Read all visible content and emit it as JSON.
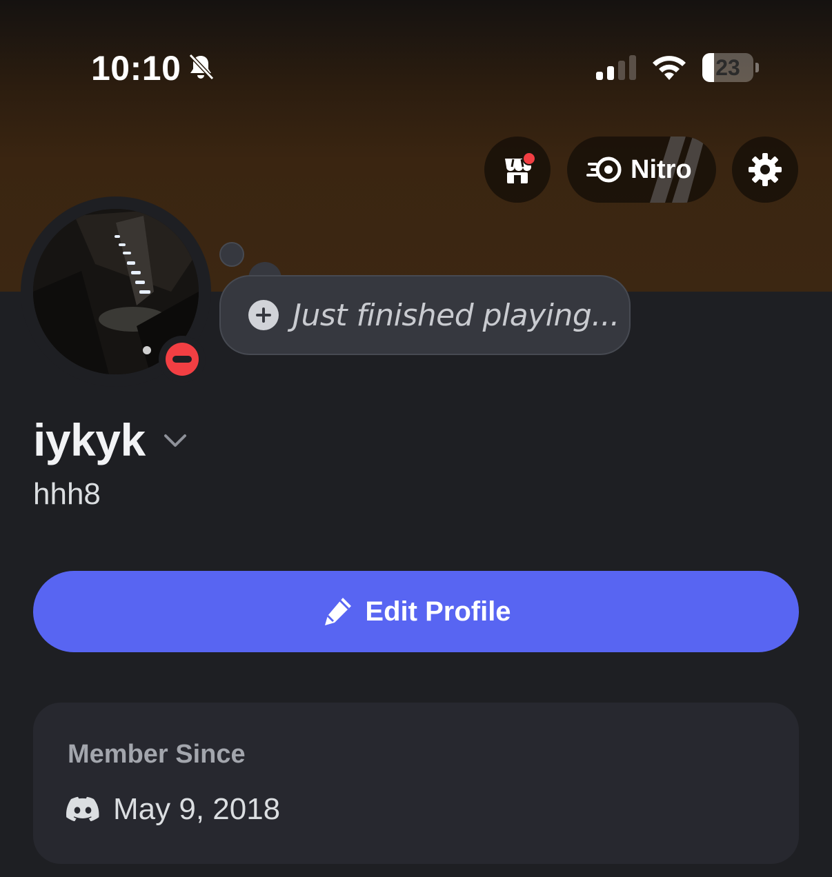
{
  "status_bar": {
    "time": "10:10",
    "battery_level": "23",
    "battery_fraction": 0.23
  },
  "top_actions": {
    "shop_icon": "shop-icon",
    "nitro_label": "Nitro",
    "settings_icon": "gear-icon"
  },
  "profile": {
    "status": "do-not-disturb",
    "custom_status_placeholder": "Just finished playing...",
    "display_name": "iykyk",
    "username": "hhh8"
  },
  "edit_button": {
    "label": "Edit Profile"
  },
  "member_since": {
    "title": "Member Since",
    "date": "May 9, 2018"
  },
  "colors": {
    "background": "#1e1f23",
    "accent": "#5865f2",
    "dnd": "#f23f43",
    "card": "#27282f"
  }
}
